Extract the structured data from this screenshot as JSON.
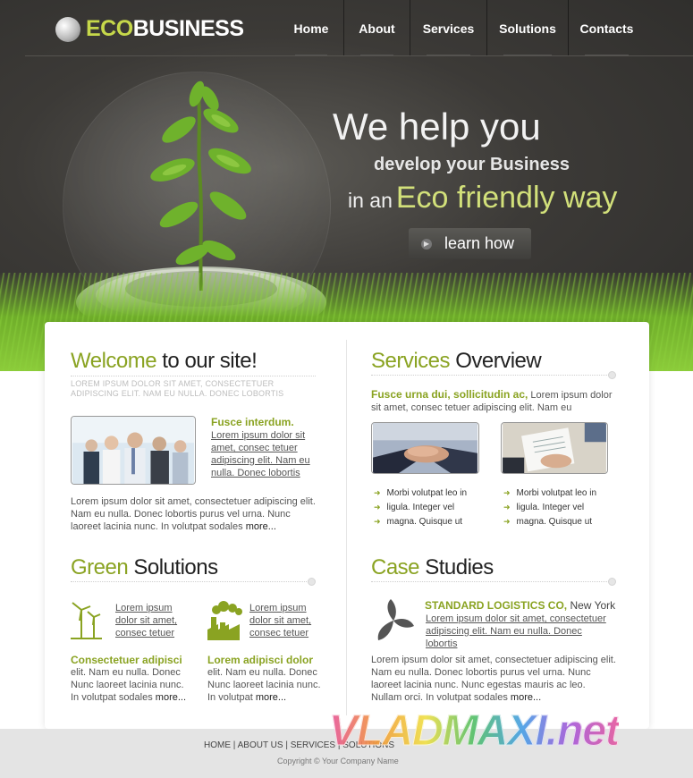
{
  "header": {
    "logo": {
      "eco": "ECO",
      "business": "BUSINESS"
    },
    "nav": [
      {
        "label": "Home"
      },
      {
        "label": "About"
      },
      {
        "label": "Services"
      },
      {
        "label": "Solutions"
      },
      {
        "label": "Contacts"
      }
    ]
  },
  "hero": {
    "line1": "We help you",
    "line2": "develop your Business",
    "line3_prefix": "in an",
    "line3_highlight": "Eco friendly way",
    "button": "learn how"
  },
  "welcome": {
    "title_highlight": "Welcome",
    "title_rest": " to our site!",
    "caps_text": "Lorem ipsum dolor sit amet, consectetuer adipiscing elit. Nam eu nulla. Donec lobortis",
    "feature_head": "Fusce interdum.",
    "feature_link": "Lorem ipsum dolor sit amet, consec tetuer adipiscing elit. Nam eu nulla. Donec lobortis",
    "body": "Lorem ipsum dolor sit amet, consectetuer adipiscing elit. Nam eu nulla. Donec lobortis purus vel urna. Nunc laoreet lacinia nunc. In volutpat sodales",
    "more": "more..."
  },
  "services": {
    "title_highlight": "Services",
    "title_rest": " Overview",
    "lead_head": "Fusce urna dui, sollicitudin ac,",
    "lead_body": " Lorem ipsum dolor sit amet, consec tetuer adipiscing elit. Nam eu",
    "bullets_left": [
      "Morbi volutpat leo in",
      "ligula. Integer vel",
      "magna. Quisque ut"
    ],
    "bullets_right": [
      "Morbi volutpat leo in",
      "ligula. Integer vel",
      "magna. Quisque ut"
    ]
  },
  "green": {
    "title_highlight": "Green",
    "title_rest": " Solutions",
    "item1_link": "Lorem ipsum dolor sit amet, consec tetuer",
    "item2_link": "Lorem ipsum dolor sit amet, consec tetuer",
    "col1_head": "Consectetuer adipisci",
    "col1_body": "elit. Nam eu nulla. Donec Nunc laoreet lacinia nunc. In volutpat sodales",
    "col2_head": "Lorem adipisci dolor",
    "col2_body": "elit. Nam eu nulla. Donec Nunc laoreet lacinia nunc. In volutpat",
    "more": "more..."
  },
  "cases": {
    "title_highlight": "Case",
    "title_rest": " Studies",
    "company": "STANDARD LOGISTICS CO,",
    "city": " New York",
    "link": "Lorem ipsum dolor sit amet, consectetuer adipiscing elit. Nam eu nulla. Donec lobortis",
    "body": "Lorem ipsum dolor sit amet, consectetuer adipiscing elit. Nam eu nulla. Donec lobortis purus vel urna. Nunc laoreet lacinia nunc. Nunc egestas mauris ac leo. Nullam orci. In volutpat sodales",
    "more": "more..."
  },
  "footer": {
    "links": "HOME | ABOUT US | SERVICES | SOLUTIONS",
    "copyright": "Copyright © Your Company Name"
  },
  "watermark": "VLADMAXI.net",
  "colors": {
    "accent_green": "#8aa322",
    "header_dark": "#3c3a37",
    "logo_green": "#c6d84a"
  }
}
